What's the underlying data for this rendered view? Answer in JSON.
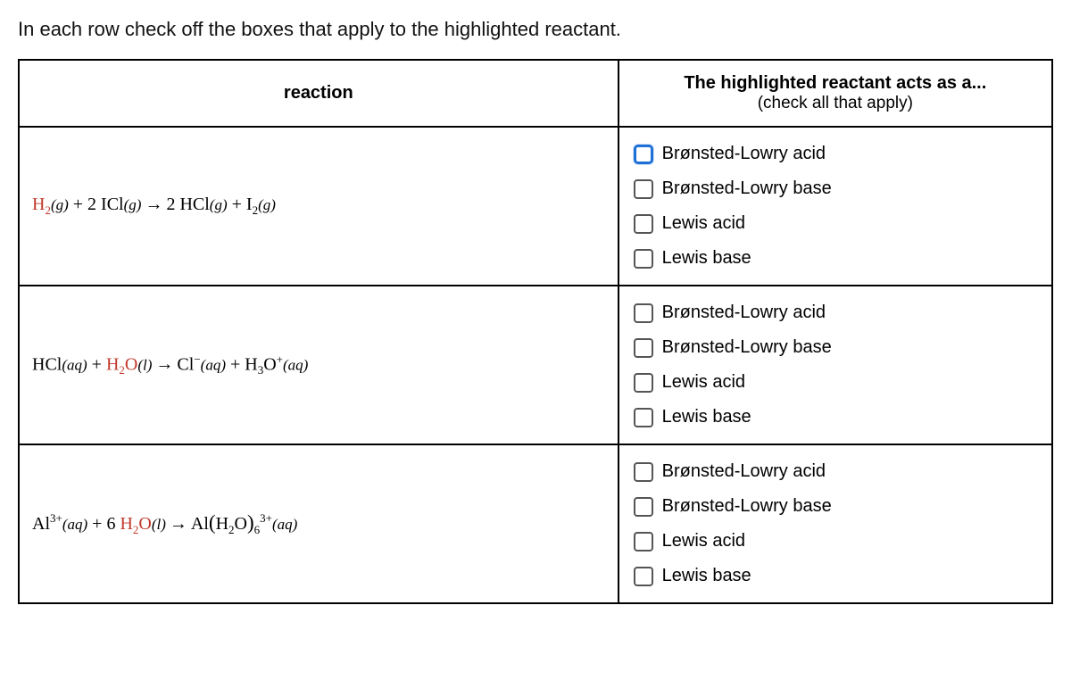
{
  "instruction": "In each row check off the boxes that apply to the highlighted reactant.",
  "headers": {
    "reaction": "reaction",
    "acts_as": "The highlighted reactant acts as a...",
    "check_all": "(check all that apply)"
  },
  "option_labels": {
    "bl_acid": "Brønsted-Lowry acid",
    "bl_base": "Brønsted-Lowry base",
    "lewis_acid": "Lewis acid",
    "lewis_base": "Lewis base"
  },
  "rows": [
    {
      "reaction_parts": {
        "r1_hl": "H",
        "r1_sub": "2",
        "r1_state": "(g)",
        "plus1": " + 2 ICl",
        "plus1_state": "(g)",
        "arrow": " → ",
        "p1": "2 HCl",
        "p1_state": "(g)",
        "plus2": " + I",
        "p2_sub": "2",
        "p2_state": "(g)"
      },
      "focused_index": 0
    },
    {
      "reaction_parts": {
        "r1": "HCl",
        "r1_state": "(aq)",
        "plus1": " + ",
        "r2_hl": "H",
        "r2_sub": "2",
        "r2_hl2": "O",
        "r2_state": "(l)",
        "arrow": " → ",
        "p1": "Cl",
        "p1_sup": "−",
        "p1_state": "(aq)",
        "plus2": " + H",
        "p2_sub": "3",
        "p2_o": "O",
        "p2_sup": "+",
        "p2_state": "(aq)"
      },
      "focused_index": -1
    },
    {
      "reaction_parts": {
        "r1": "Al",
        "r1_sup": "3+",
        "r1_state": "(aq)",
        "plus1": " + 6 ",
        "r2_hl": "H",
        "r2_sub": "2",
        "r2_hl2": "O",
        "r2_state": "(l)",
        "arrow": " → ",
        "p1": "Al",
        "p1_paren_o": "(",
        "p1_in": "H",
        "p1_in_sub": "2",
        "p1_in2": "O",
        "p1_paren_c": ")",
        "p1_sub_out": "6",
        "p1_sup_out": "3+",
        "p1_state": "(aq)"
      },
      "focused_index": -1
    }
  ]
}
